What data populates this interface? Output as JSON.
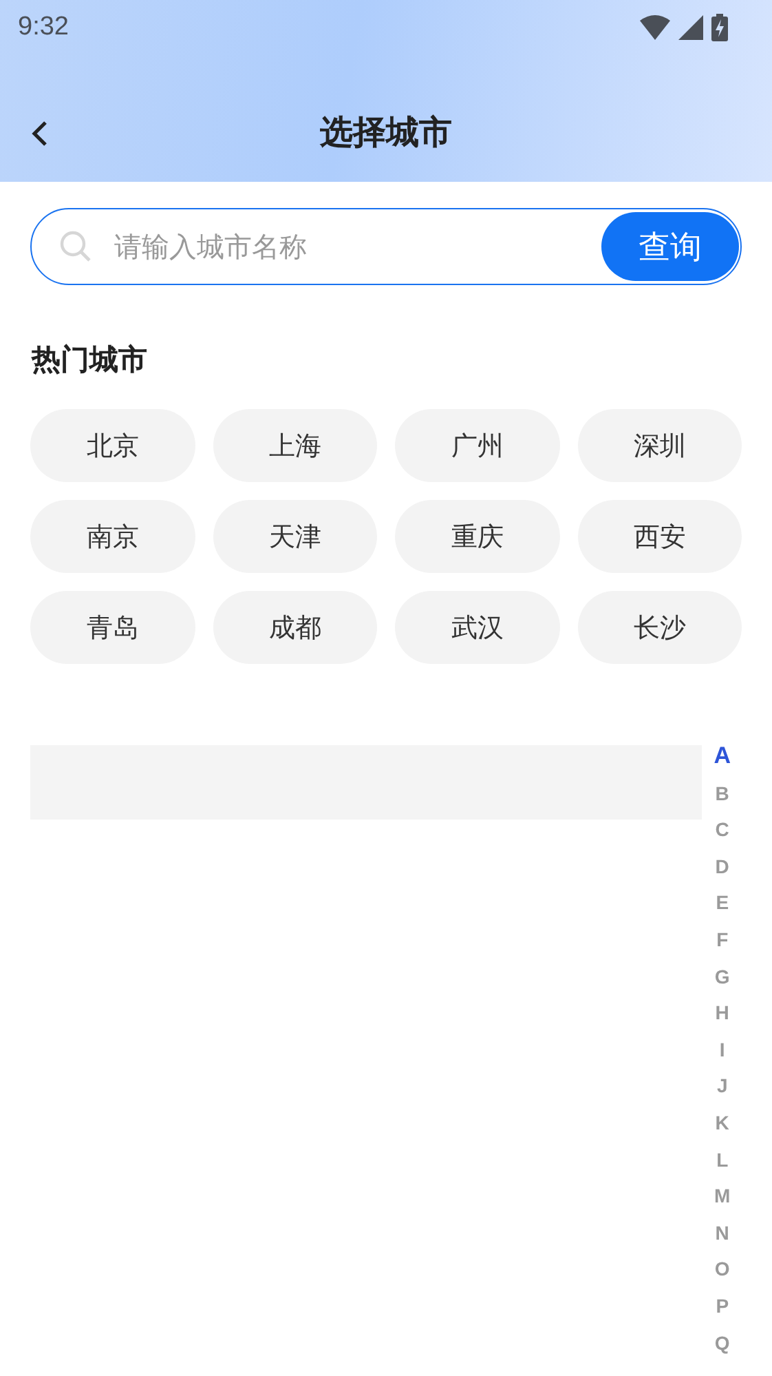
{
  "status_bar": {
    "time": "9:32"
  },
  "header": {
    "title": "选择城市"
  },
  "search": {
    "placeholder": "请输入城市名称",
    "button": "查询"
  },
  "hot_cities": {
    "title": "热门城市",
    "items": [
      "北京",
      "上海",
      "广州",
      "深圳",
      "南京",
      "天津",
      "重庆",
      "西安",
      "青岛",
      "成都",
      "武汉",
      "长沙"
    ]
  },
  "index": [
    {
      "letter": "A",
      "selected": true
    },
    {
      "letter": "B",
      "selected": false
    },
    {
      "letter": "C",
      "selected": false
    },
    {
      "letter": "D",
      "selected": false
    },
    {
      "letter": "E",
      "selected": false
    },
    {
      "letter": "F",
      "selected": false
    },
    {
      "letter": "G",
      "selected": false
    },
    {
      "letter": "H",
      "selected": false
    },
    {
      "letter": "I",
      "selected": false
    },
    {
      "letter": "J",
      "selected": false
    },
    {
      "letter": "K",
      "selected": false
    },
    {
      "letter": "L",
      "selected": false
    },
    {
      "letter": "M",
      "selected": false
    },
    {
      "letter": "N",
      "selected": false
    },
    {
      "letter": "O",
      "selected": false
    },
    {
      "letter": "P",
      "selected": false
    },
    {
      "letter": "Q",
      "selected": false
    }
  ]
}
